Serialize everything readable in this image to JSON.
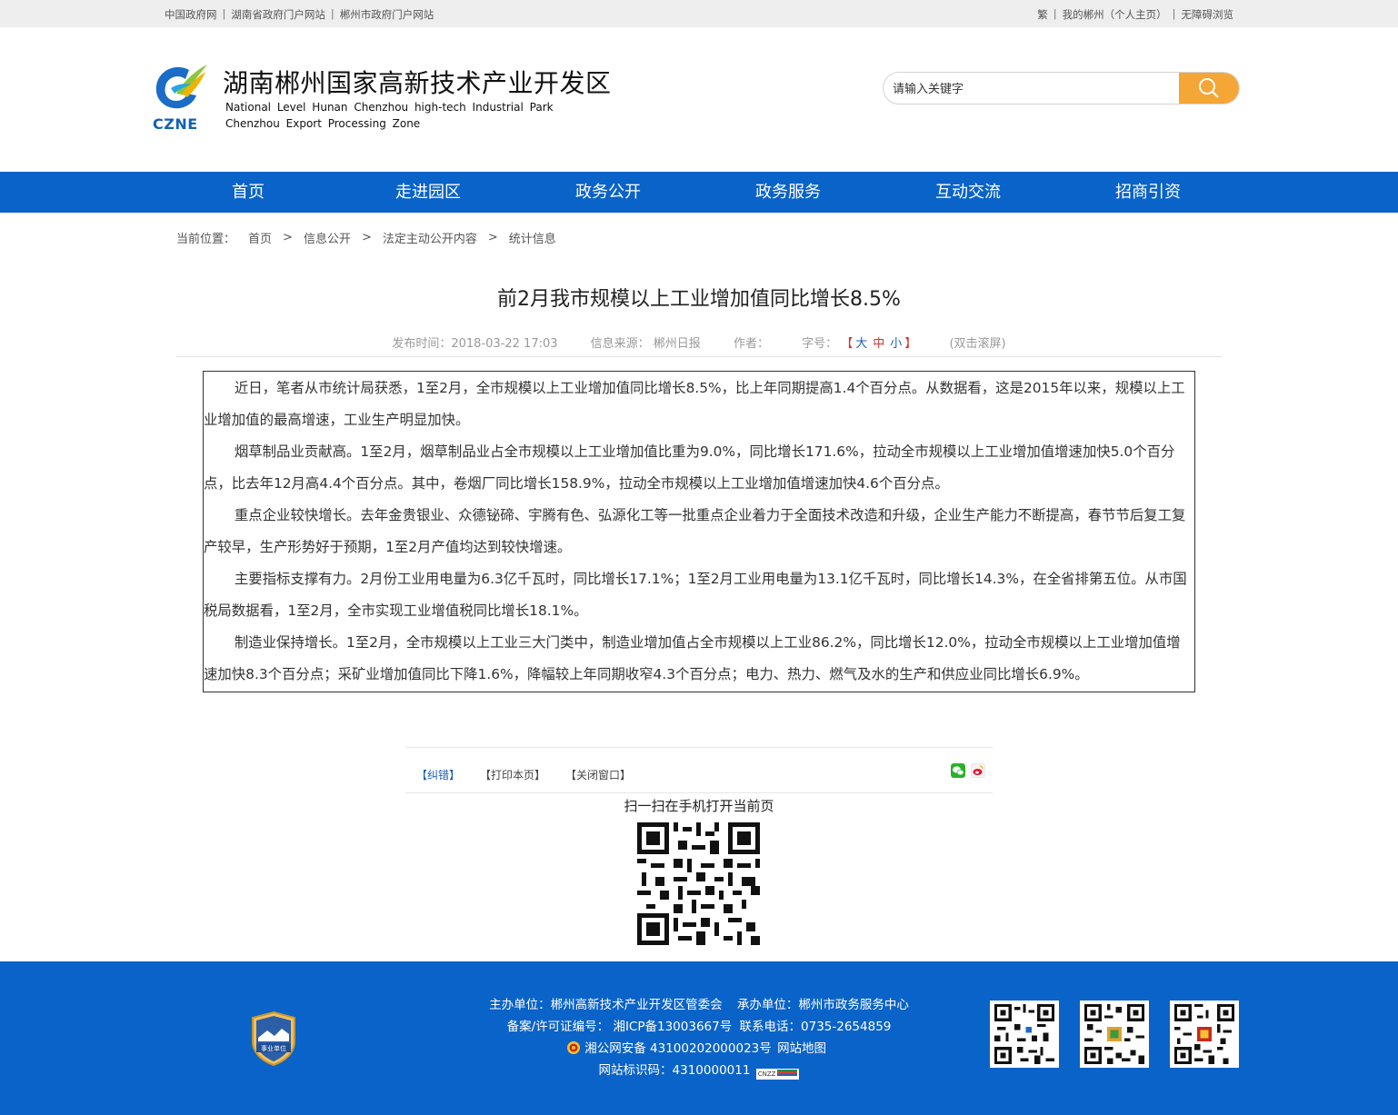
{
  "topbar": {
    "left_links": [
      "中国政府网",
      "湖南省政府门户网站",
      "郴州市政府门户网站"
    ],
    "right_links": [
      "繁",
      "我的郴州（个人主页）",
      "无障碍浏览"
    ]
  },
  "header": {
    "logo_text": "CZNE",
    "title": "湖南郴州国家高新技术产业开发区",
    "subtitle_en_1": "National Level Hunan Chenzhou high-tech Industrial Park",
    "subtitle_en_2": "Chenzhou Export Processing Zone"
  },
  "search": {
    "placeholder": "请输入关键字",
    "button_icon": "search-icon"
  },
  "nav": {
    "items": [
      "首页",
      "走进园区",
      "政务公开",
      "政务服务",
      "互动交流",
      "招商引资"
    ]
  },
  "breadcrumb": {
    "label": "当前位置：",
    "items": [
      "首页",
      "信息公开",
      "法定主动公开内容",
      "统计信息"
    ]
  },
  "article": {
    "title": "前2月我市规模以上工业增加值同比增长8.5%",
    "meta": {
      "publish_time": "发布时间：2018-03-22 17:03",
      "source": "信息来源： 郴州日报",
      "author": "作者：",
      "font_size_label": "字号：",
      "font_large": "大",
      "font_medium": "中",
      "font_small": "小",
      "dblclick_scroll": "(双击滚屏)"
    },
    "paragraphs": [
      "近日，笔者从市统计局获悉，1至2月，全市规模以上工业增加值同比增长8.5%，比上年同期提高1.4个百分点。从数据看，这是2015年以来，规模以上工业增加值的最高增速，工业生产明显加快。",
      "烟草制品业贡献高。1至2月，烟草制品业占全市规模以上工业增加值比重为9.0%，同比增长171.6%，拉动全市规模以上工业增加值增速加快5.0个百分点，比去年12月高4.4个百分点。其中，卷烟厂同比增长158.9%，拉动全市规模以上工业增加值增速加快4.6个百分点。",
      "重点企业较快增长。去年金贵银业、众德铋碲、宇腾有色、弘源化工等一批重点企业着力于全面技术改造和升级，企业生产能力不断提高，春节节后复工复产较早，生产形势好于预期，1至2月产值均达到较快增速。",
      "主要指标支撑有力。2月份工业用电量为6.3亿千瓦时，同比增长17.1%；1至2月工业用电量为13.1亿千瓦时，同比增长14.3%，在全省排第五位。从市国税局数据看，1至2月，全市实现工业增值税同比增长18.1%。",
      "制造业保持增长。1至2月，全市规模以上工业三大门类中，制造业增加值占全市规模以上工业86.2%，同比增长12.0%，拉动全市规模以上工业增加值增速加快8.3个百分点；采矿业增加值同比下降1.6%，降幅较上年同期收窄4.3个百分点；电力、热力、燃气及水的生产和供应业同比增长6.9%。"
    ]
  },
  "tools": {
    "correct": "【纠错】",
    "print": "【打印本页】",
    "close": "【关闭窗口】",
    "share_icons": [
      "wechat-icon",
      "weibo-icon"
    ],
    "scan_text": "扫一扫在手机打开当前页"
  },
  "footer": {
    "badge_text": "事业单位",
    "host": "主办单位：郴州高新技术产业开发区管委会",
    "undertake": "承办单位：郴州市政务服务中心",
    "icp": "备案/许可证编号： 湘ICP备13003667号",
    "phone": "联系电话：0735-2654859",
    "police": "湘公网安备 43100202000023号",
    "sitemap": "网站地图",
    "site_id": "网站标识码：4310000011",
    "cnzz": "CNZZ"
  },
  "colors": {
    "nav_blue": "#0a63c8",
    "search_orange": "#f4a637",
    "font_accent_red": "#d0342c",
    "font_accent_blue": "#1a5fb4"
  }
}
